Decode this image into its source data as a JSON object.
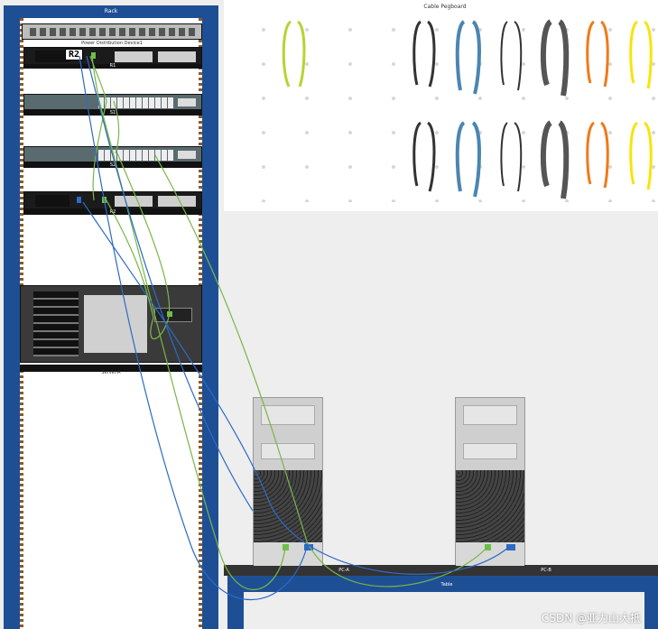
{
  "rack": {
    "title": "Rack"
  },
  "devices": {
    "pdu": "Power Distribution Device1",
    "r1": "R1",
    "s1": "S1",
    "s2": "S2",
    "r2": "R2",
    "server": "Server-A"
  },
  "tag": {
    "selected_device": "R2"
  },
  "pegboard": {
    "title": "Cable Pegboard"
  },
  "pcs": {
    "pc_a": "PC-A",
    "pc_b": "PC-B"
  },
  "table": {
    "label": "Table"
  },
  "watermark": "CSDN @亚力山大抵",
  "colors": {
    "rack_blue": "#1e4f95",
    "cable_green": "#7ab648",
    "cable_blue": "#2c6bc5",
    "cable_orange": "#f07a1a",
    "cable_yellow": "#f5e50b"
  }
}
